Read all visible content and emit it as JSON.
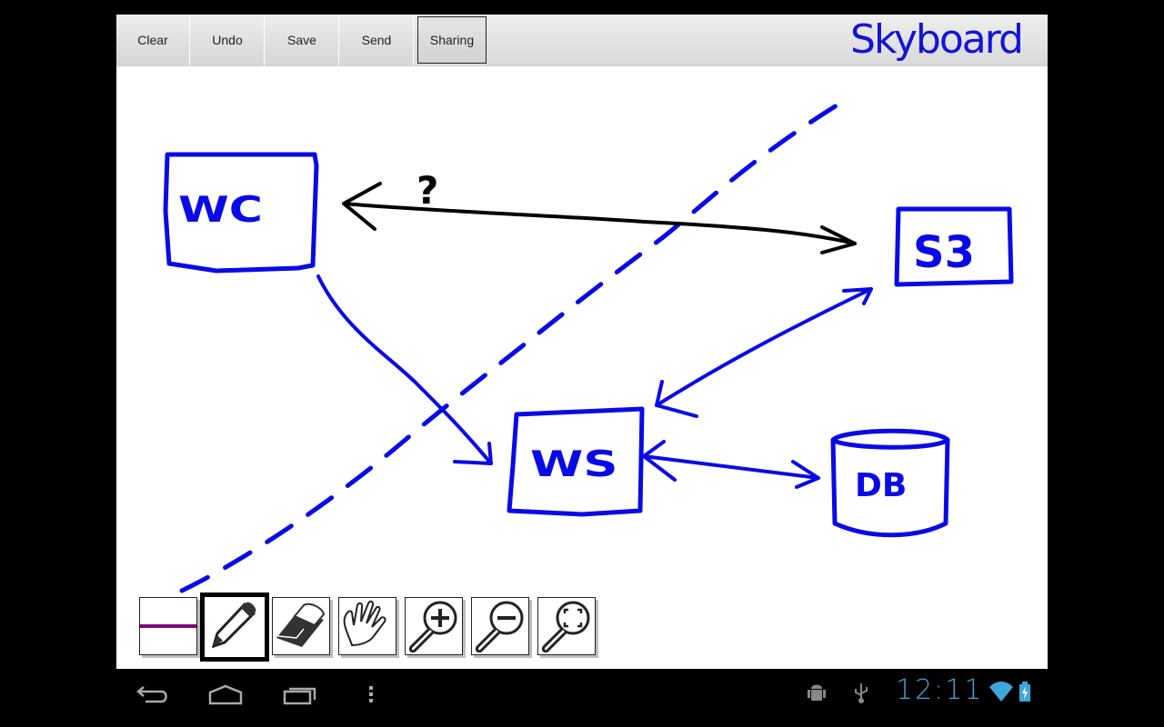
{
  "app": {
    "name": "Skyboard",
    "logo_text": "Skyboard",
    "brand_color": "#1414d8"
  },
  "toolbar": {
    "buttons": [
      {
        "label": "Clear",
        "active": false
      },
      {
        "label": "Undo",
        "active": false
      },
      {
        "label": "Save",
        "active": false
      },
      {
        "label": "Send",
        "active": false
      },
      {
        "label": "Sharing",
        "active": true
      }
    ]
  },
  "drawing": {
    "ink_colors": {
      "blue": "#0a0ae6",
      "black": "#000000"
    },
    "labels": [
      {
        "id": "wc",
        "text": "WC"
      },
      {
        "id": "s3",
        "text": "S3"
      },
      {
        "id": "ws",
        "text": "WS"
      },
      {
        "id": "db",
        "text": "DB"
      },
      {
        "id": "question",
        "text": "?"
      }
    ]
  },
  "tools": {
    "current_color": "#7a0a7a",
    "items": [
      {
        "name": "color-picker",
        "icon": "color-swatch-icon",
        "selected": false
      },
      {
        "name": "pencil",
        "icon": "pencil-icon",
        "selected": true
      },
      {
        "name": "eraser",
        "icon": "eraser-icon",
        "selected": false
      },
      {
        "name": "pan",
        "icon": "hand-icon",
        "selected": false
      },
      {
        "name": "zoom-in",
        "icon": "zoom-in-icon",
        "selected": false
      },
      {
        "name": "zoom-out",
        "icon": "zoom-out-icon",
        "selected": false
      },
      {
        "name": "zoom-fit",
        "icon": "zoom-fit-icon",
        "selected": false
      }
    ]
  },
  "system_bar": {
    "nav": [
      "back-icon",
      "home-icon",
      "recent-apps-icon",
      "menu-icon"
    ],
    "status_icons": [
      "android-debug-icon",
      "usb-icon",
      "wifi-icon",
      "battery-charging-icon"
    ],
    "time": "12:11",
    "accent_color": "#3fa6d8"
  }
}
